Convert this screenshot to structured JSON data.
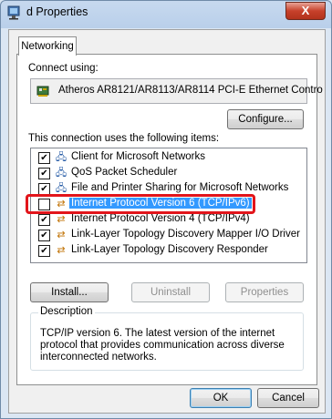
{
  "window": {
    "title": "d Properties",
    "close_label": "X"
  },
  "tabs": [
    {
      "label": "Networking"
    }
  ],
  "connect_using": {
    "label": "Connect using:",
    "adapter": "Atheros AR8121/AR8113/AR8114 PCI-E Ethernet Contro",
    "configure_button": "Configure..."
  },
  "items_section": {
    "label": "This connection uses the following items:",
    "items": [
      {
        "label": "Client for Microsoft Networks",
        "checked": "true",
        "icon": "network-client-icon"
      },
      {
        "label": "QoS Packet Scheduler",
        "checked": "true",
        "icon": "network-service-icon"
      },
      {
        "label": "File and Printer Sharing for Microsoft Networks",
        "checked": "true",
        "icon": "network-service-icon"
      },
      {
        "label": "Internet Protocol Version 6 (TCP/IPv6)",
        "checked": "false",
        "icon": "protocol-icon",
        "selected": "true"
      },
      {
        "label": "Internet Protocol Version 4 (TCP/IPv4)",
        "checked": "true",
        "icon": "protocol-icon"
      },
      {
        "label": "Link-Layer Topology Discovery Mapper I/O Driver",
        "checked": "true",
        "icon": "protocol-icon"
      },
      {
        "label": "Link-Layer Topology Discovery Responder",
        "checked": "true",
        "icon": "protocol-icon"
      }
    ]
  },
  "actions": {
    "install": "Install...",
    "uninstall": "Uninstall",
    "properties": "Properties"
  },
  "description": {
    "title": "Description",
    "text": "TCP/IP version 6. The latest version of the internet protocol that provides communication across diverse interconnected networks."
  },
  "footer": {
    "ok": "OK",
    "cancel": "Cancel"
  },
  "colors": {
    "highlight": "#e2151b",
    "selection": "#3399ff"
  }
}
